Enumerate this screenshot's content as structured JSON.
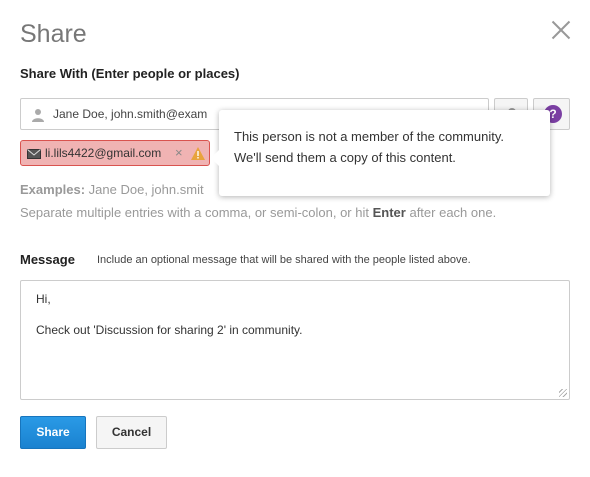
{
  "dialog": {
    "title": "Share",
    "share_with_label": "Share With (Enter people or places)",
    "people_input_value": "Jane Doe, john.smith@exam",
    "chip": {
      "email": "li.lils4422@gmail.com",
      "remove": "×"
    },
    "examples_label": "Examples:",
    "examples_value": "Jane Doe, john.smit",
    "separate_before": "Separate multiple entries with a comma, or semi-colon, or hit",
    "separate_key": "Enter",
    "separate_after": "after each one.",
    "tooltip": {
      "line1": "This person is not a member of the community.",
      "line2": "We'll send them a copy of this content."
    },
    "help_glyph": "?",
    "message_label": "Message",
    "message_hint": "Include an optional message that will be shared with the people listed above.",
    "message_line1": "Hi,",
    "message_line2": "Check out 'Discussion for sharing 2' in community.",
    "share_button": "Share",
    "cancel_button": "Cancel"
  },
  "colors": {
    "accent": "#1a82d0",
    "chip_error_bg": "#f0b3b3",
    "warn": "#e8a33d",
    "help": "#7b3fa3"
  }
}
